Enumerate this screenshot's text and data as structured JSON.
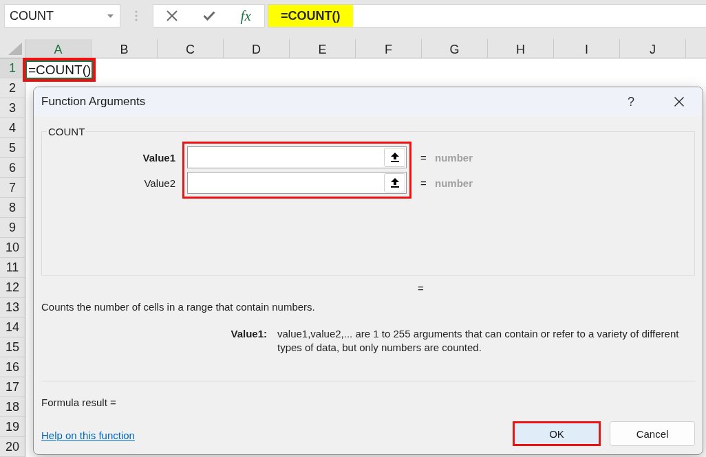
{
  "name_box": {
    "value": "COUNT"
  },
  "formula_bar": {
    "function_button": "fx",
    "value": "=COUNT()",
    "highlighted": true
  },
  "sheet": {
    "columns": [
      {
        "label": "A",
        "selected": true
      },
      {
        "label": "B",
        "selected": false
      },
      {
        "label": "C",
        "selected": false
      },
      {
        "label": "D",
        "selected": false
      },
      {
        "label": "E",
        "selected": false
      },
      {
        "label": "F",
        "selected": false
      },
      {
        "label": "G",
        "selected": false
      },
      {
        "label": "H",
        "selected": false
      },
      {
        "label": "I",
        "selected": false
      },
      {
        "label": "J",
        "selected": false
      }
    ],
    "rows": [
      {
        "label": "1",
        "selected": true
      },
      {
        "label": "2",
        "selected": false
      },
      {
        "label": "3",
        "selected": false
      },
      {
        "label": "4",
        "selected": false
      },
      {
        "label": "5",
        "selected": false
      },
      {
        "label": "6",
        "selected": false
      },
      {
        "label": "7",
        "selected": false
      },
      {
        "label": "8",
        "selected": false
      },
      {
        "label": "9",
        "selected": false
      },
      {
        "label": "10",
        "selected": false
      },
      {
        "label": "11",
        "selected": false
      },
      {
        "label": "12",
        "selected": false
      },
      {
        "label": "13",
        "selected": false
      },
      {
        "label": "14",
        "selected": false
      },
      {
        "label": "15",
        "selected": false
      },
      {
        "label": "16",
        "selected": false
      },
      {
        "label": "17",
        "selected": false
      },
      {
        "label": "18",
        "selected": false
      },
      {
        "label": "19",
        "selected": false
      },
      {
        "label": "20",
        "selected": false
      }
    ],
    "active_cell": {
      "value": "=COUNT()",
      "highlighted": true
    }
  },
  "dialog": {
    "title": "Function Arguments",
    "help_button": "?",
    "function_name": "COUNT",
    "arguments_highlighted": true,
    "arguments": [
      {
        "label": "Value1",
        "selected": true,
        "equals": "=",
        "result": "number"
      },
      {
        "label": "Value2",
        "selected": false,
        "equals": "=",
        "result": "number"
      }
    ],
    "result_equals": "=",
    "description": "Counts the number of cells in a range that contain numbers.",
    "argument_help": {
      "label": "Value1:",
      "text": "value1,value2,... are 1 to 255 arguments that can contain or refer to a variety of different types of data, but only numbers are counted."
    },
    "formula_result": "Formula result =",
    "help_link": "Help on this function",
    "buttons": [
      {
        "label": "OK",
        "kind": "primary",
        "highlighted": true
      },
      {
        "label": "Cancel",
        "kind": "secondary",
        "highlighted": false
      }
    ]
  }
}
